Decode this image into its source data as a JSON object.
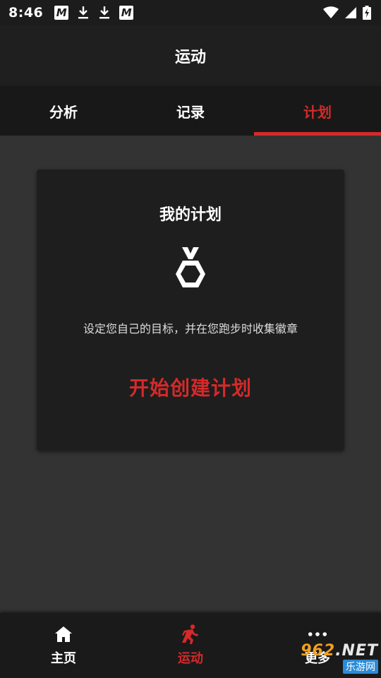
{
  "status_bar": {
    "time": "8:46",
    "left_icons": [
      "m-app-icon",
      "download-icon",
      "download-icon",
      "m-app-icon"
    ],
    "m_letter": "M",
    "right_icons": [
      "wifi-icon",
      "signal-icon",
      "battery-charging-icon"
    ]
  },
  "app_bar": {
    "title": "运动"
  },
  "tabs": [
    {
      "label": "分析",
      "active": false
    },
    {
      "label": "记录",
      "active": false
    },
    {
      "label": "计划",
      "active": true
    }
  ],
  "plan_card": {
    "title": "我的计划",
    "icon": "medal-icon",
    "description": "设定您自己的目标，并在您跑步时收集徽章",
    "action_label": "开始创建计划"
  },
  "bottom_nav": [
    {
      "label": "主页",
      "icon": "home-icon",
      "active": false
    },
    {
      "label": "运动",
      "icon": "running-icon",
      "active": true
    },
    {
      "label": "更多",
      "icon": "more-icon",
      "active": false
    }
  ],
  "watermark": {
    "top_prefix": "962",
    "top_suffix": ".NET",
    "bottom": "乐游网"
  },
  "colors": {
    "accent": "#d42a2a",
    "background": "#333333",
    "card": "#1e1e1e",
    "bar": "#1f1f1f"
  }
}
